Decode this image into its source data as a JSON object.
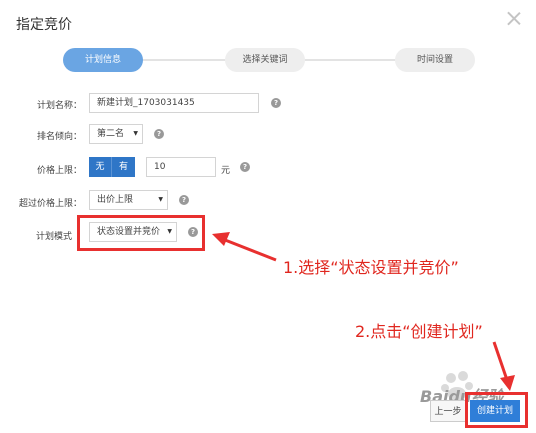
{
  "dialog": {
    "title": "指定竞价"
  },
  "steps": [
    {
      "label": "计划信息",
      "active": true
    },
    {
      "label": "选择关键词",
      "active": false
    },
    {
      "label": "时间设置",
      "active": false
    }
  ],
  "form": {
    "plan_name": {
      "label": "计划名称：",
      "value": "新建计划_1703031435"
    },
    "rank": {
      "label": "排名倾向：",
      "value": "第二名"
    },
    "price_limit": {
      "label": "价格上限：",
      "options": [
        "无",
        "有"
      ],
      "value": "10",
      "unit": "元"
    },
    "over_limit": {
      "label": "超过价格上限：",
      "value": "出价上限"
    },
    "plan_mode": {
      "label": "计划模式",
      "value": "状态设置并竞价"
    },
    "help_glyph": "?"
  },
  "annotations": {
    "step1": "1.选择“状态设置并竞价”",
    "step2": "2.点击“创建计划”"
  },
  "footer": {
    "prev_label": "上一步",
    "create_label": "创建计划"
  },
  "watermark": {
    "text": "Baidu经验"
  },
  "colors": {
    "primary": "#2f76c7",
    "step_active": "#6aa5e3",
    "annotation": "#e8302f"
  }
}
